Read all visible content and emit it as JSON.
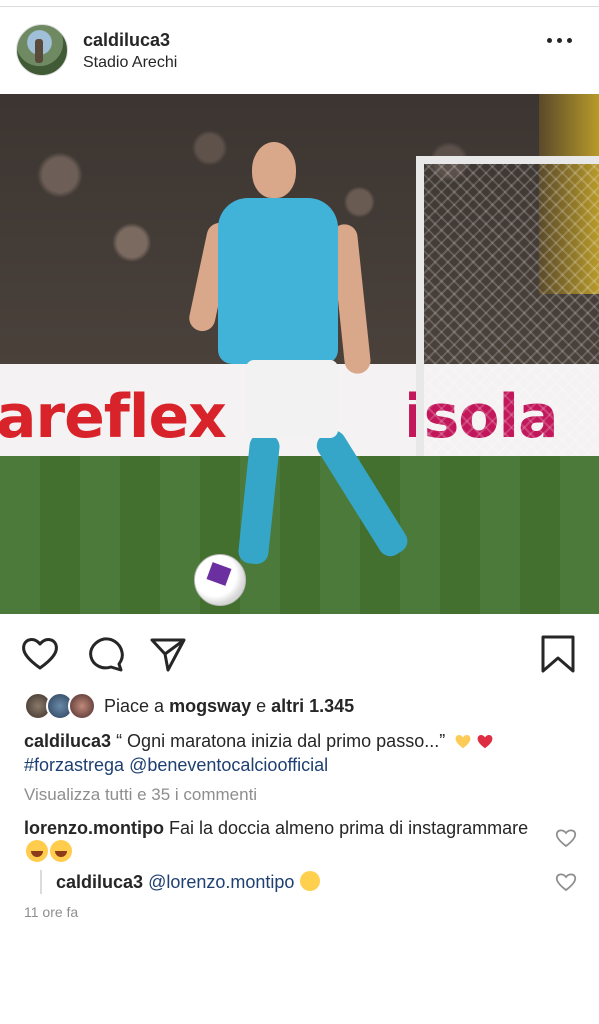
{
  "post": {
    "username": "caldiluca3",
    "location": "Stadio Arechi"
  },
  "photo": {
    "ad_text_left": "areflex",
    "ad_text_right": "isola"
  },
  "likes": {
    "prefix": "Piace a",
    "liker": "mogsway",
    "middle": "e",
    "others": "altri 1.345"
  },
  "caption": {
    "username": "caldiluca3",
    "text": "“ Ogni maratona inizia dal primo passo...” ",
    "hashtag": "#forzastrega",
    "mention": "@beneventocalcioofficial"
  },
  "comments": {
    "view_all": "Visualizza tutti e 35 i commenti",
    "items": [
      {
        "username": "lorenzo.montipo",
        "text": "Fai la doccia almeno prima di instagrammare"
      },
      {
        "username": "caldiluca3",
        "mention": "@lorenzo.montipo"
      }
    ]
  },
  "timestamp": "11 ore fa",
  "icons": [
    "more-icon",
    "heart-icon",
    "comment-icon",
    "share-icon",
    "bookmark-icon"
  ]
}
